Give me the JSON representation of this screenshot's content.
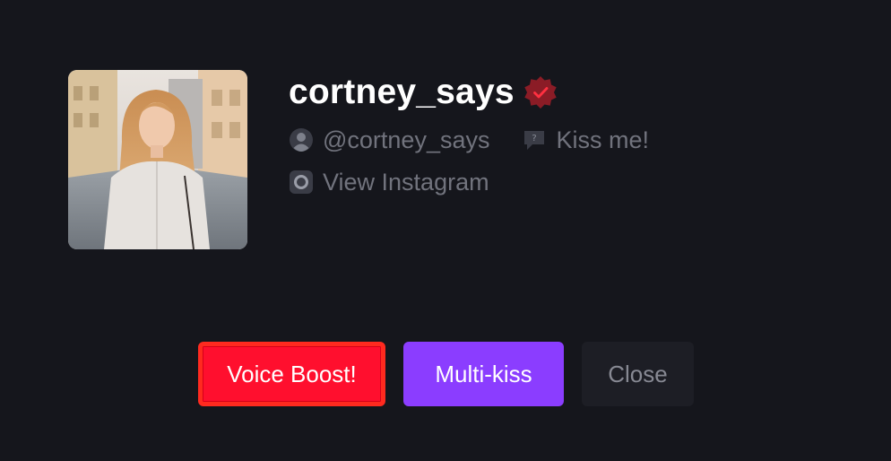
{
  "profile": {
    "username": "cortney_says",
    "handle": "@cortney_says",
    "status": "Kiss me!",
    "instagram_label": "View Instagram",
    "verified_color": "#8b1c26"
  },
  "actions": {
    "voice_boost": "Voice Boost!",
    "multi_kiss": "Multi-kiss",
    "close": "Close"
  },
  "colors": {
    "background": "#15161c",
    "boost": "#ff0f2e",
    "kiss": "#8b3dff",
    "close_bg": "#1d1e25"
  }
}
